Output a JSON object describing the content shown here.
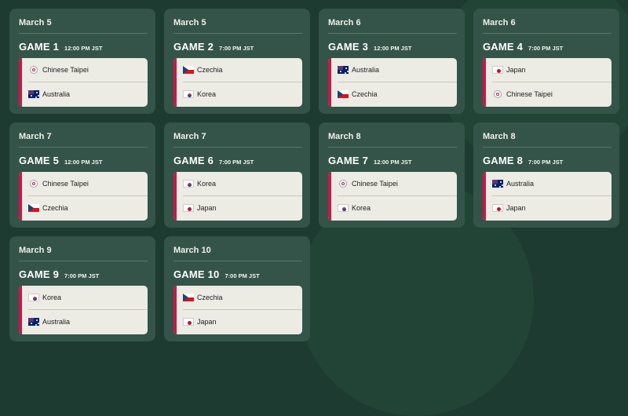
{
  "games": [
    {
      "date": "March 5",
      "game": "GAME 1",
      "time": "12:00 PM JST",
      "home": {
        "team": "Chinese Taipei",
        "flag": "chinese-taipei-flag-icon"
      },
      "away": {
        "team": "Australia",
        "flag": "australia-flag-icon"
      }
    },
    {
      "date": "March 5",
      "game": "GAME 2",
      "time": "7:00 PM JST",
      "home": {
        "team": "Czechia",
        "flag": "czechia-flag-icon"
      },
      "away": {
        "team": "Korea",
        "flag": "korea-flag-icon"
      }
    },
    {
      "date": "March 6",
      "game": "GAME 3",
      "time": "12:00 PM JST",
      "home": {
        "team": "Australia",
        "flag": "australia-flag-icon"
      },
      "away": {
        "team": "Czechia",
        "flag": "czechia-flag-icon"
      }
    },
    {
      "date": "March 6",
      "game": "GAME 4",
      "time": "7:00 PM JST",
      "home": {
        "team": "Japan",
        "flag": "japan-flag-icon"
      },
      "away": {
        "team": "Chinese Taipei",
        "flag": "chinese-taipei-flag-icon"
      }
    },
    {
      "date": "March 7",
      "game": "GAME 5",
      "time": "12:00 PM JST",
      "home": {
        "team": "Chinese Taipei",
        "flag": "chinese-taipei-flag-icon"
      },
      "away": {
        "team": "Czechia",
        "flag": "czechia-flag-icon"
      }
    },
    {
      "date": "March 7",
      "game": "GAME 6",
      "time": "7:00 PM JST",
      "home": {
        "team": "Korea",
        "flag": "korea-flag-icon"
      },
      "away": {
        "team": "Japan",
        "flag": "japan-flag-icon"
      }
    },
    {
      "date": "March 8",
      "game": "GAME 7",
      "time": "12:00 PM JST",
      "home": {
        "team": "Chinese Taipei",
        "flag": "chinese-taipei-flag-icon"
      },
      "away": {
        "team": "Korea",
        "flag": "korea-flag-icon"
      }
    },
    {
      "date": "March 8",
      "game": "GAME 8",
      "time": "7:00 PM JST",
      "home": {
        "team": "Australia",
        "flag": "australia-flag-icon"
      },
      "away": {
        "team": "Japan",
        "flag": "japan-flag-icon"
      }
    },
    {
      "date": "March 9",
      "game": "GAME 9",
      "time": "7:00 PM JST",
      "home": {
        "team": "Korea",
        "flag": "korea-flag-icon"
      },
      "away": {
        "team": "Australia",
        "flag": "australia-flag-icon"
      }
    },
    {
      "date": "March 10",
      "game": "GAME 10",
      "time": "7:00 PM JST",
      "home": {
        "team": "Czechia",
        "flag": "czechia-flag-icon"
      },
      "away": {
        "team": "Japan",
        "flag": "japan-flag-icon"
      }
    }
  ],
  "colors": {
    "background": "#1d3b30",
    "card": "#345449",
    "accent": "#c8174a",
    "team_panel": "#ecebe4"
  }
}
